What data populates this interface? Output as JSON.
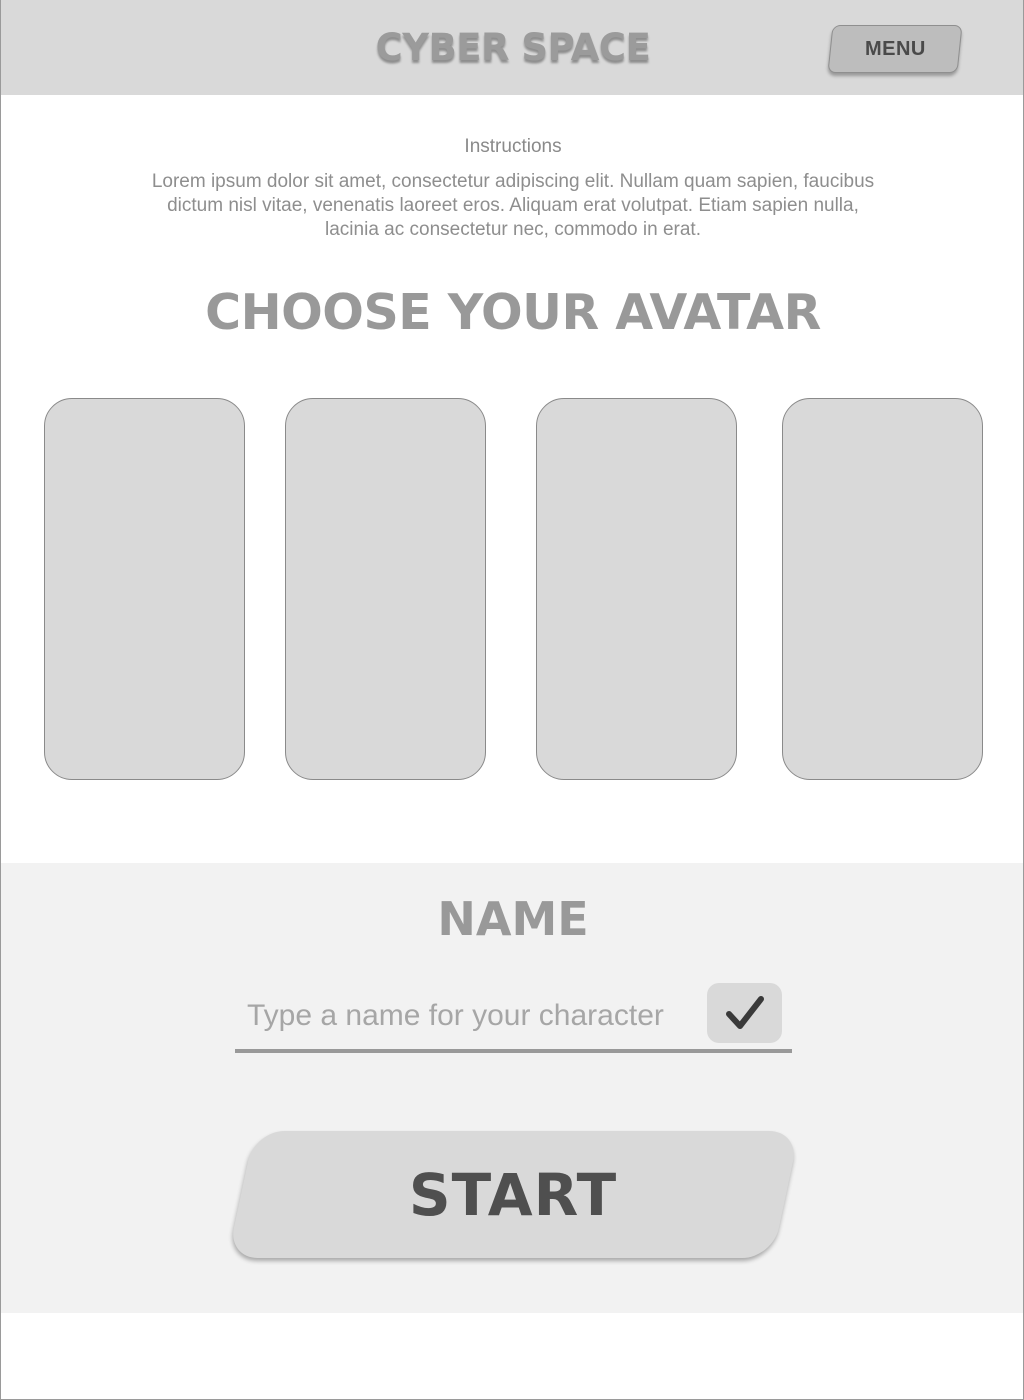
{
  "header": {
    "title": "CYBER SPACE",
    "menu_label": "MENU"
  },
  "instructions": {
    "title": "Instructions",
    "body": "Lorem ipsum dolor sit amet, consectetur adipiscing elit. Nullam quam sapien, faucibus dictum nisl vitae, venenatis laoreet eros. Aliquam erat volutpat. Etiam sapien nulla, lacinia ac consectetur nec, commodo in erat."
  },
  "avatar_section": {
    "title": "CHOOSE YOUR AVATAR"
  },
  "name_section": {
    "title": "NAME",
    "input_placeholder": "Type a name for your character",
    "input_value": "",
    "confirm_icon": "checkmark-icon"
  },
  "start_label": "START",
  "colors": {
    "header_bg": "#d9d9d9",
    "panel_bg": "#f2f2f2",
    "card_bg": "#d9d9d9",
    "heading_text": "#999999",
    "button_text": "#4f4f4f"
  }
}
